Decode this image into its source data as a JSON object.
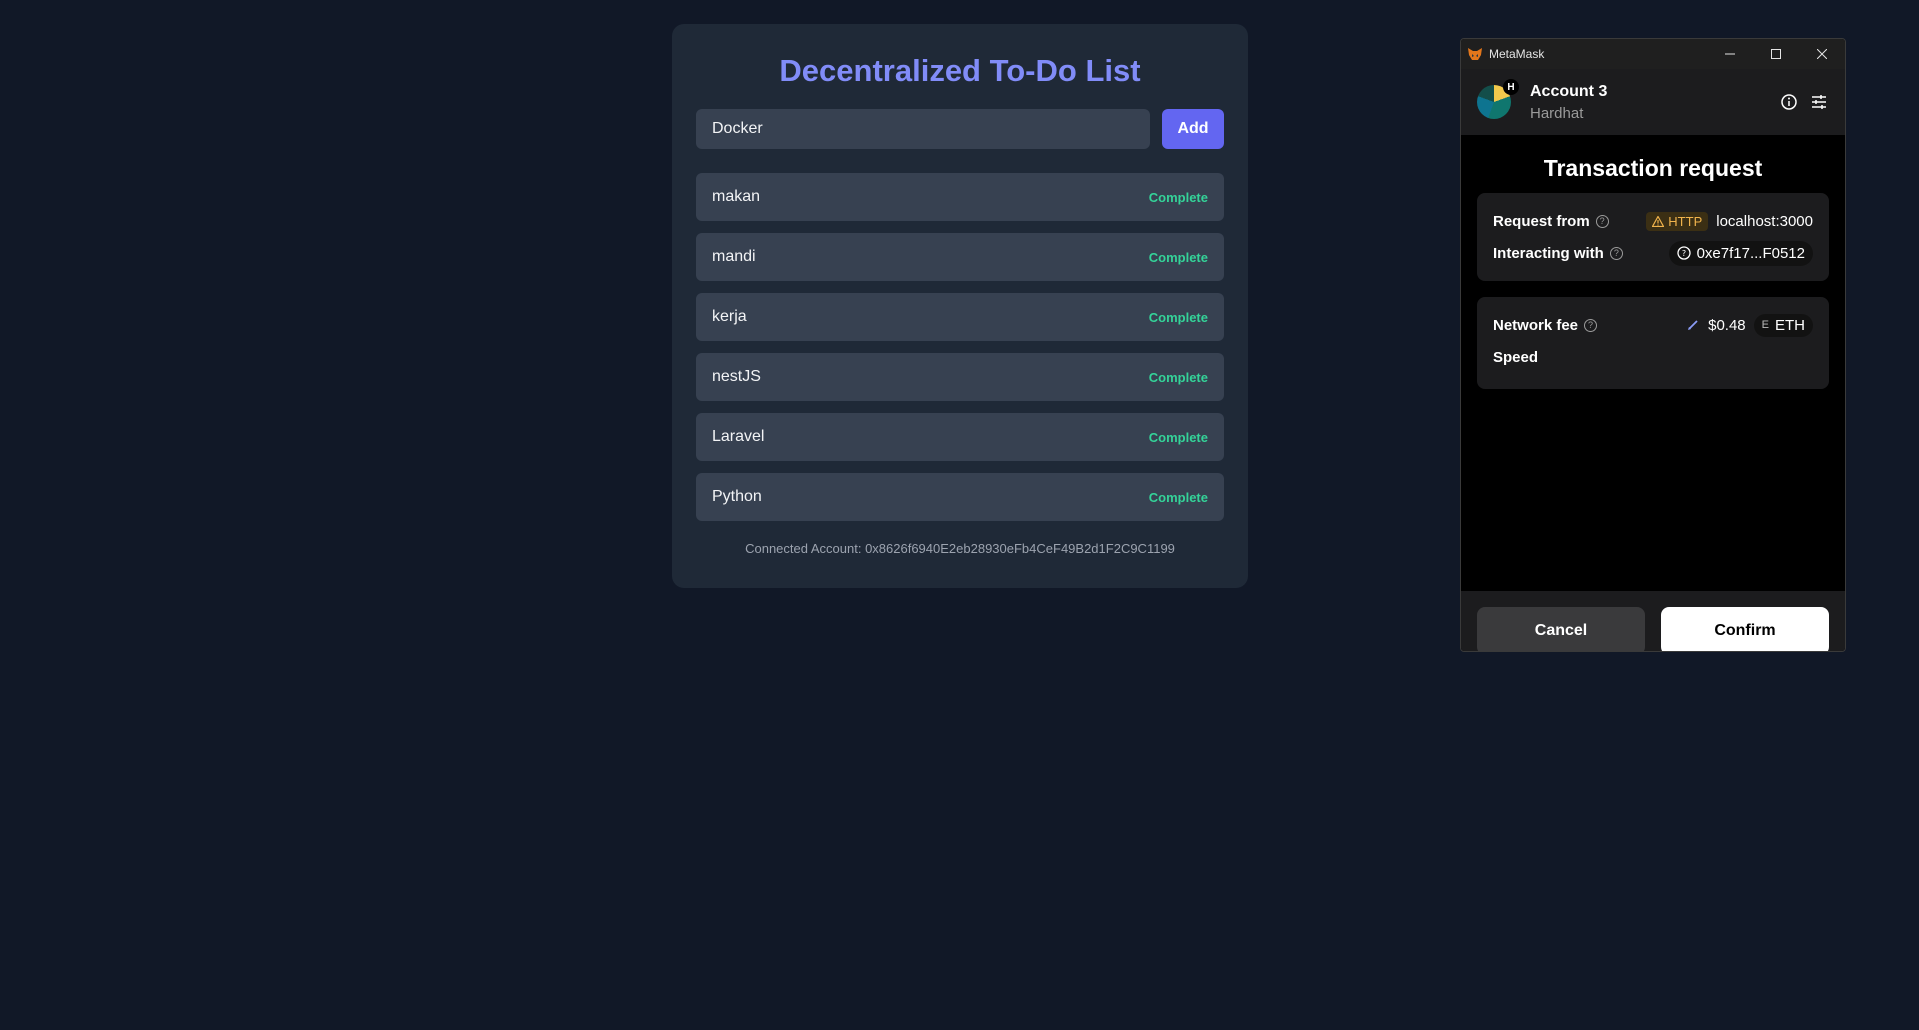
{
  "todo": {
    "title": "Decentralized To-Do List",
    "input_value": "Docker",
    "add_label": "Add",
    "tasks": [
      {
        "text": "makan",
        "action": "Complete"
      },
      {
        "text": "mandi",
        "action": "Complete"
      },
      {
        "text": "kerja",
        "action": "Complete"
      },
      {
        "text": "nestJS",
        "action": "Complete"
      },
      {
        "text": "Laravel",
        "action": "Complete"
      },
      {
        "text": "Python",
        "action": "Complete"
      }
    ],
    "connected_account": "Connected Account: 0x8626f6940E2eb28930eFb4CeF49B2d1F2C9C1199"
  },
  "metamask": {
    "window_title": "MetaMask",
    "account_name": "Account 3",
    "network": "Hardhat",
    "avatar_badge": "H",
    "tx_title": "Transaction request",
    "request_from_label": "Request from",
    "http_badge": "HTTP",
    "origin": "localhost:3000",
    "interacting_label": "Interacting with",
    "contract_address": "0xe7f17...F0512",
    "network_fee_label": "Network fee",
    "fee_value": "$0.48",
    "fee_token": "ETH",
    "fee_token_mark": "E",
    "speed_label": "Speed",
    "cancel_label": "Cancel",
    "confirm_label": "Confirm"
  },
  "colors": {
    "background": "#111827",
    "card": "#1f2937",
    "accent": "#6366f1",
    "title": "#818cf8",
    "complete": "#34d399"
  }
}
